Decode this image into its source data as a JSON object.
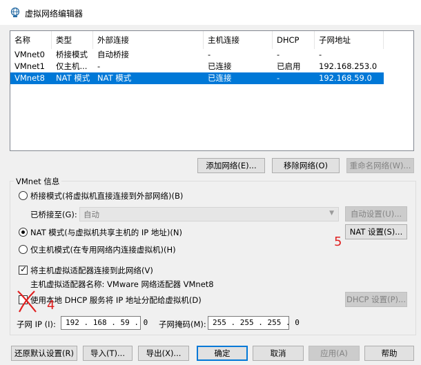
{
  "window": {
    "title": "虚拟网络编辑器",
    "icon": "network-globe-icon"
  },
  "network_list": {
    "columns": [
      "名称",
      "类型",
      "外部连接",
      "主机连接",
      "DHCP",
      "子网地址"
    ],
    "rows": [
      {
        "name": "VMnet0",
        "type": "桥接模式",
        "external": "自动桥接",
        "host": "-",
        "dhcp": "-",
        "subnet": "-"
      },
      {
        "name": "VMnet1",
        "type": "仅主机...",
        "external": "-",
        "host": "已连接",
        "dhcp": "已启用",
        "subnet": "192.168.253.0"
      },
      {
        "name": "VMnet8",
        "type": "NAT 模式",
        "external": "NAT 模式",
        "host": "已连接",
        "dhcp": "-",
        "subnet": "192.168.59.0"
      }
    ],
    "selected_row": "VMnet8"
  },
  "list_buttons": {
    "add": "添加网络(E)...",
    "remove": "移除网络(O)",
    "rename": "重命名网络(W)..."
  },
  "vmnet_info": {
    "group_title": "VMnet 信息",
    "bridge_radio": "桥接模式(将虚拟机直接连接到外部网络)(B)",
    "bridged_to_label": "已桥接至(G):",
    "bridged_to_value": "自动",
    "auto_settings": "自动设置(U)...",
    "nat_radio": "NAT 模式(与虚拟机共享主机的 IP 地址)(N)",
    "nat_settings": "NAT 设置(S)...",
    "host_only_radio": "仅主机模式(在专用网络内连接虚拟机)(H)",
    "connect_adapter_checkbox": "将主机虚拟适配器连接到此网络(V)",
    "adapter_name_text": "主机虚拟适配器名称: VMware 网络适配器 VMnet8",
    "dhcp_checkbox": "使用本地 DHCP 服务将 IP 地址分配给虚拟机(D)",
    "dhcp_settings": "DHCP 设置(P)...",
    "subnet_ip_label": "子网 IP (I):",
    "subnet_ip_value": "192 . 168 . 59 . 0",
    "subnet_mask_label": "子网掩码(M):",
    "subnet_mask_value": "255 . 255 . 255 . 0",
    "selected_mode": "nat",
    "connect_adapter_checked": true,
    "dhcp_checked": false
  },
  "annotations": {
    "mark_4": "4",
    "mark_5": "5",
    "color": "#e02020"
  },
  "bottom_buttons": {
    "restore_defaults": "还原默认设置(R)",
    "import": "导入(T)...",
    "export": "导出(X)...",
    "ok": "确定",
    "cancel": "取消",
    "apply": "应用(A)",
    "help": "帮助"
  },
  "colors": {
    "selection": "#0078d7",
    "background": "#f0f0f0"
  }
}
